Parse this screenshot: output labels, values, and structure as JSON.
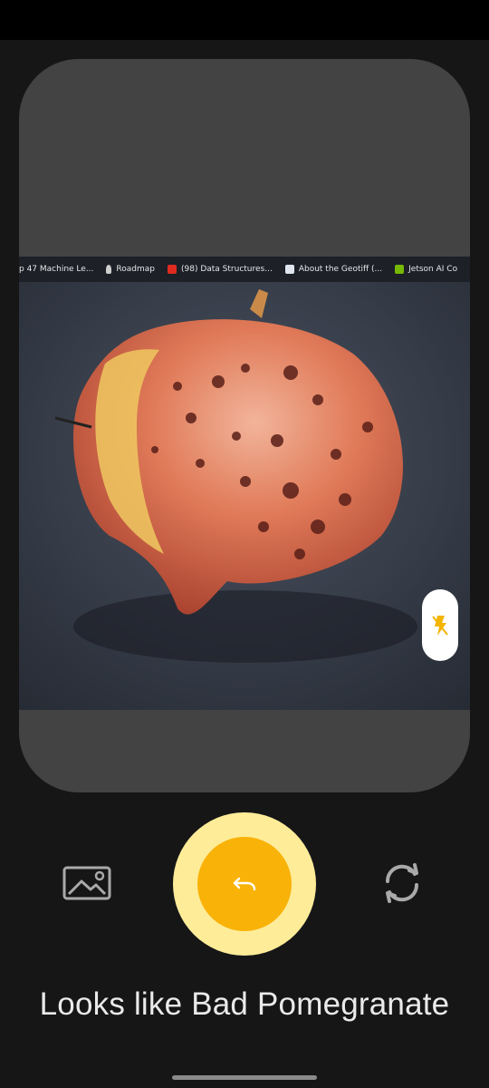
{
  "photo": {
    "bookmarks": [
      {
        "label": "p 47 Machine Le...",
        "icon": "page-icon"
      },
      {
        "label": "Roadmap",
        "icon": "bell-icon"
      },
      {
        "label": "(98) Data Structures...",
        "icon": "youtube-icon"
      },
      {
        "label": "About the Geotiff (...",
        "icon": "site-icon"
      },
      {
        "label": "Jetson AI Co",
        "icon": "nvidia-icon"
      }
    ]
  },
  "controls": {
    "flash_icon": "flash-off-icon",
    "gallery_icon": "gallery-icon",
    "capture_icon": "undo-icon",
    "switch_icon": "switch-camera-icon"
  },
  "result_text": "Looks like Bad Pomegranate",
  "colors": {
    "background": "#161616",
    "preview": "#434343",
    "capture_outer": "#ffec99",
    "capture_inner": "#f9b208",
    "flash_icon": "#f4b400"
  }
}
